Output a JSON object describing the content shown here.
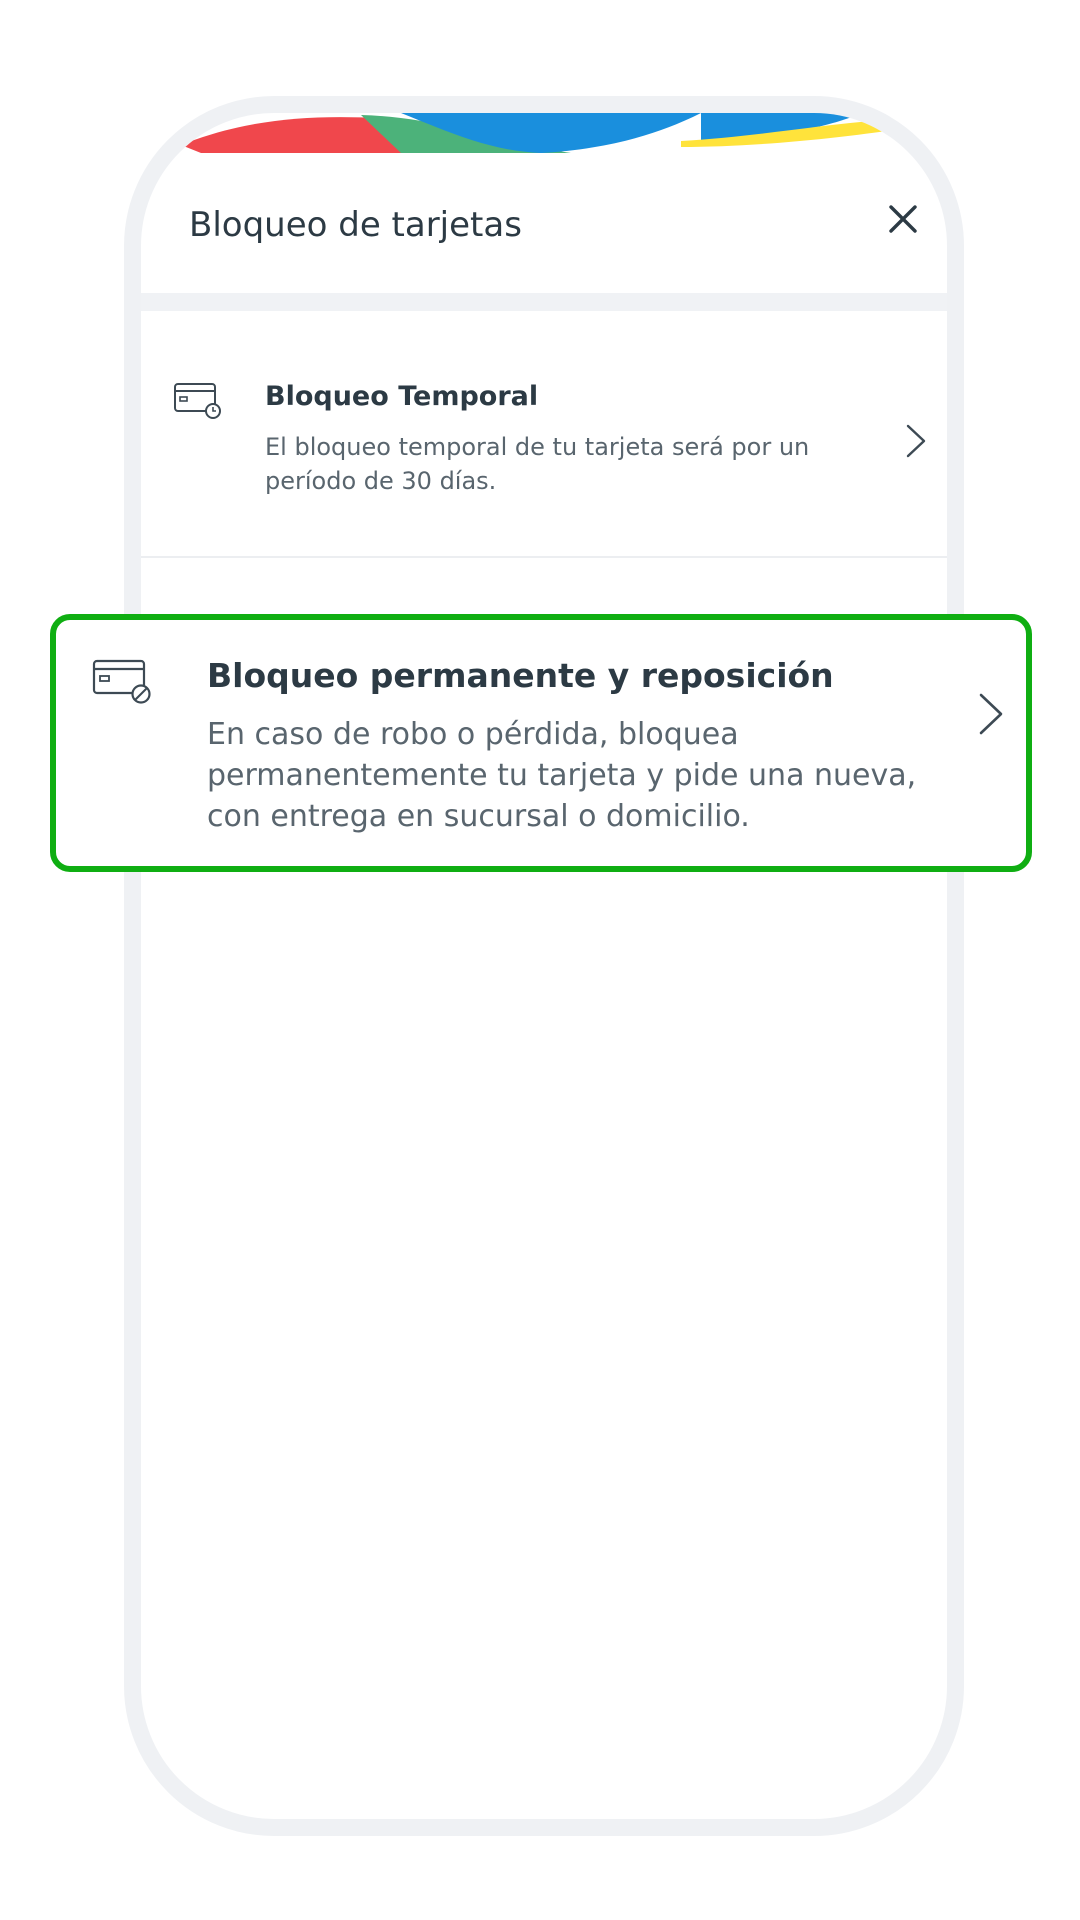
{
  "header": {
    "title": "Bloqueo de tarjetas",
    "close_icon": "close-icon"
  },
  "options": {
    "temporal": {
      "title": "Bloqueo Temporal",
      "description": "El bloqueo temporal de tu tarjeta será por un período de 30 días.",
      "icon": "card-clock-icon"
    },
    "permanente": {
      "title": "Bloqueo permanente y reposición",
      "description": "En caso de robo o pérdida, bloquea permanentemente tu tarjeta y pide una nueva, con entrega en sucursal o domicilio.",
      "icon": "card-block-icon"
    }
  },
  "colors": {
    "highlight": "#0fae12",
    "wave_red": "#f0474c",
    "wave_green": "#4cb27a",
    "wave_blue": "#1a8fdd",
    "wave_yellow": "#ffe33b",
    "text_primary": "#2c3a44",
    "text_secondary": "#59656e"
  }
}
